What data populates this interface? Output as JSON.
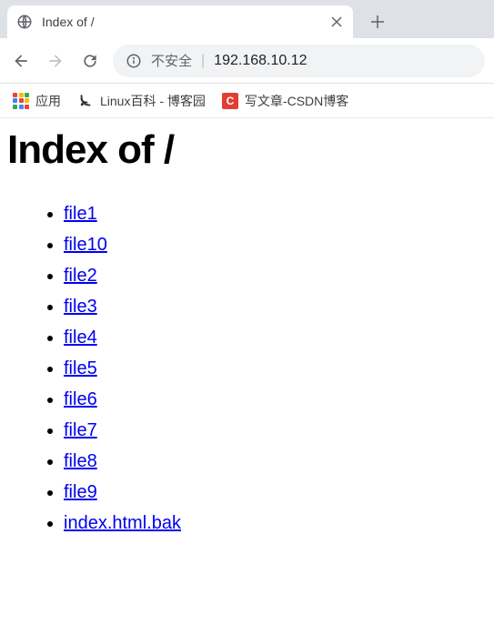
{
  "tab": {
    "title": "Index of /"
  },
  "address": {
    "not_secure_label": "不安全",
    "url": "192.168.10.12"
  },
  "bookmarks": {
    "apps_label": "应用",
    "item1_label": "Linux百科 - 博客园",
    "item2_label": "写文章-CSDN博客"
  },
  "page": {
    "heading": "Index of /",
    "files": [
      "file1",
      "file10",
      "file2",
      "file3",
      "file4",
      "file5",
      "file6",
      "file7",
      "file8",
      "file9",
      "index.html.bak"
    ]
  }
}
